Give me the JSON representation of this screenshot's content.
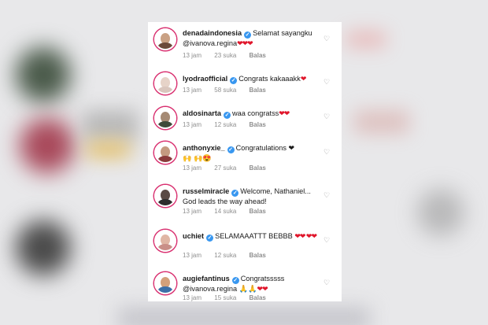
{
  "comments": [
    {
      "username": "denadaindonesia",
      "text": "Selamat sayangku @ivanova.regina",
      "hearts": "❤❤❤",
      "time": "13 jam",
      "likes": "23 suka",
      "reply": "Balas",
      "avatar": "#6b4a3a"
    },
    {
      "username": "lyodraofficial",
      "text": "Congrats kakaaakk",
      "hearts": "❤",
      "time": "13 jam",
      "likes": "58 suka",
      "reply": "Balas",
      "avatar": "#d9c6bd"
    },
    {
      "username": "aldosinarta",
      "text": "waa congratss",
      "hearts": "❤❤",
      "time": "13 jam",
      "likes": "12 suka",
      "reply": "Balas",
      "avatar": "#3e4a3a"
    },
    {
      "username": "anthonyxie_",
      "text": "Congratulations ❤🙌 🙌😍",
      "hearts": "",
      "time": "13 jam",
      "likes": "27 suka",
      "reply": "Balas",
      "avatar": "#8a3b3b"
    },
    {
      "username": "russelmiracle",
      "text": "Welcome, Nathaniel... God leads the way ahead!",
      "hearts": "",
      "time": "13 jam",
      "likes": "14 suka",
      "reply": "Balas",
      "avatar": "#2d2d2d"
    },
    {
      "username": "uchiet",
      "text": "SELAMAAATTT BEBBB",
      "hearts": "❤❤ ❤❤",
      "time": "13 jam",
      "likes": "12 suka",
      "reply": "Balas",
      "avatar": "#c98f88"
    },
    {
      "username": "augiefantinus",
      "text": "Congratsssss @ivanova.regina 🙏🙏",
      "hearts": "❤❤",
      "time": "13 jam",
      "likes": "15 suka",
      "reply": "Balas",
      "avatar": "#3c6fa8"
    }
  ],
  "icons": {
    "verified": "verified-badge-icon",
    "like": "heart-outline-icon"
  },
  "colors": {
    "verified": "#3897f0",
    "heart": "#e0162b",
    "meta": "#8e8e8e",
    "story_ring": "#d93070"
  }
}
